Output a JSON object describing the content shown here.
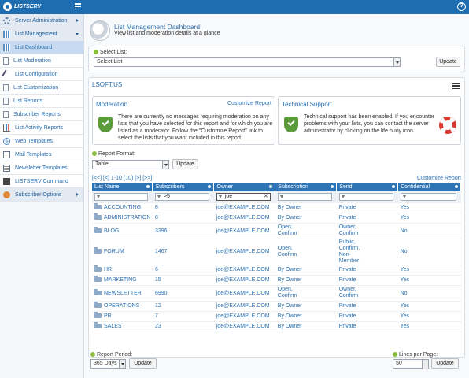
{
  "app": {
    "logo_text": "LISTSERV"
  },
  "sidebar": {
    "items": [
      {
        "label": "Server Administration",
        "icon": "gear-icon",
        "group": true
      },
      {
        "label": "List Management",
        "icon": "list-icon",
        "group": true
      },
      {
        "label": "List Dashboard",
        "icon": "dashboard-icon"
      },
      {
        "label": "List Moderation",
        "icon": "moderation-icon"
      },
      {
        "label": "List Configuration",
        "icon": "pen-icon"
      },
      {
        "label": "List Customization",
        "icon": "customize-icon"
      },
      {
        "label": "List Reports",
        "icon": "doc-icon"
      },
      {
        "label": "Subscriber Reports",
        "icon": "doc-icon"
      },
      {
        "label": "List Activity Reports",
        "icon": "chart-icon"
      },
      {
        "label": "Web Templates",
        "icon": "web-icon"
      },
      {
        "label": "Mail Templates",
        "icon": "mail-icon"
      },
      {
        "label": "Newsletter Templates",
        "icon": "newsletter-icon"
      },
      {
        "label": "LISTSERV Command",
        "icon": "command-icon"
      },
      {
        "label": "Subscriber Options",
        "icon": "user-icon",
        "group": true
      }
    ]
  },
  "header": {
    "title": "List Management Dashboard",
    "subtitle": "View list and moderation details at a glance"
  },
  "select_list": {
    "label": "Select List:",
    "value": "Select List",
    "button": "Update"
  },
  "panel": {
    "title": "LSOFT.US"
  },
  "moderation": {
    "title": "Moderation",
    "link": "Customize Report",
    "text": "There are currently no messages requiring moderation on any lists that you have selected for this report and for which you are listed as a moderator. Follow the \"Customize Report\" link to select the lists that you want included in this report."
  },
  "support": {
    "title": "Technical Support",
    "text": "Technical support has been enabled. If you encounter problems with your lists, you can contact the server administrator by clicking on the life buoy icon."
  },
  "report_format": {
    "label": "Report Format:",
    "value": "Table",
    "button": "Update"
  },
  "pager": {
    "text": "[<<] [<] 1-10 (10) [>] [>>]",
    "customize": "Customize Report"
  },
  "table": {
    "columns": [
      "List Name",
      "Subscribers",
      "Owner",
      "Subscription",
      "Send",
      "Confidential"
    ],
    "filters": [
      "",
      ">5",
      "joe",
      "",
      "",
      ""
    ],
    "rows": [
      {
        "name": "ACCOUNTING",
        "subs": "8",
        "owner": "joe@EXAMPLE.COM",
        "subscription": "By Owner",
        "send": "Private",
        "conf": "Yes"
      },
      {
        "name": "ADMINISTRATION",
        "subs": "8",
        "owner": "joe@EXAMPLE.COM",
        "subscription": "By Owner",
        "send": "Private",
        "conf": "Yes"
      },
      {
        "name": "BLOG",
        "subs": "3396",
        "owner": "joe@EXAMPLE.COM",
        "subscription": "Open, Confirm",
        "send": "Owner, Confirm",
        "conf": "No"
      },
      {
        "name": "FORUM",
        "subs": "1467",
        "owner": "joe@EXAMPLE.COM",
        "subscription": "Open, Confirm",
        "send": "Public, Confirm, Non-Member",
        "conf": "No"
      },
      {
        "name": "HR",
        "subs": "6",
        "owner": "joe@EXAMPLE.COM",
        "subscription": "By Owner",
        "send": "Private",
        "conf": "Yes"
      },
      {
        "name": "MARKETING",
        "subs": "15",
        "owner": "joe@EXAMPLE.COM",
        "subscription": "By Owner",
        "send": "Private",
        "conf": "Yes"
      },
      {
        "name": "NEWSLETTER",
        "subs": "6990",
        "owner": "joe@EXAMPLE.COM",
        "subscription": "Open, Confirm",
        "send": "Owner, Confirm",
        "conf": "No"
      },
      {
        "name": "OPERATIONS",
        "subs": "12",
        "owner": "joe@EXAMPLE.COM",
        "subscription": "By Owner",
        "send": "Private",
        "conf": "Yes"
      },
      {
        "name": "PR",
        "subs": "7",
        "owner": "joe@EXAMPLE.COM",
        "subscription": "By Owner",
        "send": "Private",
        "conf": "Yes"
      },
      {
        "name": "SALES",
        "subs": "23",
        "owner": "joe@EXAMPLE.COM",
        "subscription": "By Owner",
        "send": "Private",
        "conf": "Yes"
      }
    ]
  },
  "footer": {
    "period_label": "Report Period:",
    "period_value": "365 Days",
    "period_button": "Update",
    "lines_label": "Lines per Page:",
    "lines_value": "50",
    "lines_button": "Update"
  }
}
